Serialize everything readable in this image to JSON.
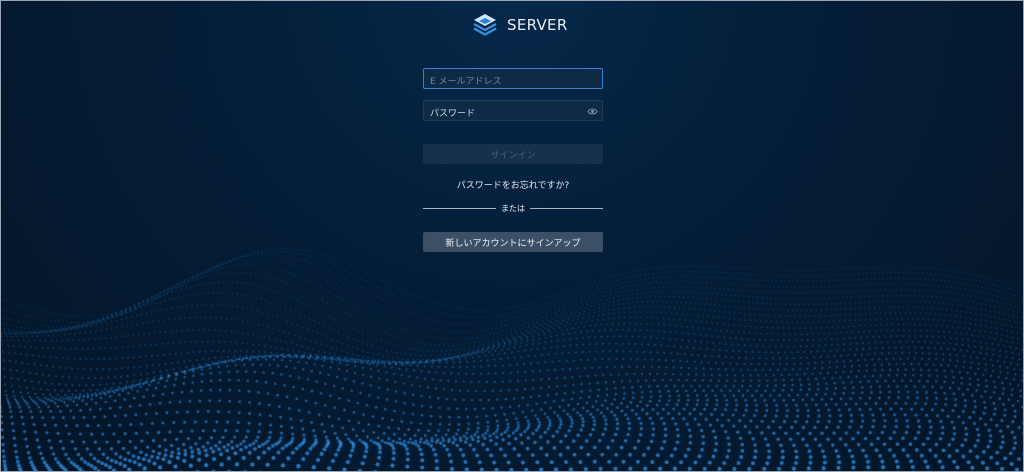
{
  "brand": {
    "name": "SERVER",
    "logo_icon": "stacked-layers-icon",
    "accent_color": "#3a8fe0"
  },
  "login_form": {
    "email_placeholder": "E メールアドレス",
    "email_value": "",
    "password_placeholder": "パスワード",
    "password_value": "",
    "password_toggle_icon": "eye-icon",
    "signin_label": "サインイン",
    "signin_state": "disabled",
    "forgot_password_link": "パスワードをお忘れですか?",
    "divider_text": "または",
    "signup_label": "新しいアカウントにサインアップ"
  },
  "background": {
    "pattern": "particle-wave",
    "base_color": "#041a30",
    "particle_color": "#2f8ee0"
  }
}
